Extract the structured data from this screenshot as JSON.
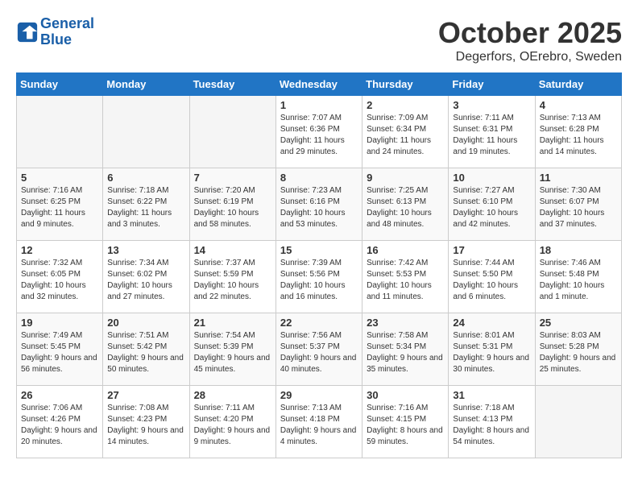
{
  "header": {
    "logo_line1": "General",
    "logo_line2": "Blue",
    "month": "October 2025",
    "location": "Degerfors, OErebro, Sweden"
  },
  "days_of_week": [
    "Sunday",
    "Monday",
    "Tuesday",
    "Wednesday",
    "Thursday",
    "Friday",
    "Saturday"
  ],
  "weeks": [
    [
      {
        "num": "",
        "info": ""
      },
      {
        "num": "",
        "info": ""
      },
      {
        "num": "",
        "info": ""
      },
      {
        "num": "1",
        "info": "Sunrise: 7:07 AM\nSunset: 6:36 PM\nDaylight: 11 hours and 29 minutes."
      },
      {
        "num": "2",
        "info": "Sunrise: 7:09 AM\nSunset: 6:34 PM\nDaylight: 11 hours and 24 minutes."
      },
      {
        "num": "3",
        "info": "Sunrise: 7:11 AM\nSunset: 6:31 PM\nDaylight: 11 hours and 19 minutes."
      },
      {
        "num": "4",
        "info": "Sunrise: 7:13 AM\nSunset: 6:28 PM\nDaylight: 11 hours and 14 minutes."
      }
    ],
    [
      {
        "num": "5",
        "info": "Sunrise: 7:16 AM\nSunset: 6:25 PM\nDaylight: 11 hours and 9 minutes."
      },
      {
        "num": "6",
        "info": "Sunrise: 7:18 AM\nSunset: 6:22 PM\nDaylight: 11 hours and 3 minutes."
      },
      {
        "num": "7",
        "info": "Sunrise: 7:20 AM\nSunset: 6:19 PM\nDaylight: 10 hours and 58 minutes."
      },
      {
        "num": "8",
        "info": "Sunrise: 7:23 AM\nSunset: 6:16 PM\nDaylight: 10 hours and 53 minutes."
      },
      {
        "num": "9",
        "info": "Sunrise: 7:25 AM\nSunset: 6:13 PM\nDaylight: 10 hours and 48 minutes."
      },
      {
        "num": "10",
        "info": "Sunrise: 7:27 AM\nSunset: 6:10 PM\nDaylight: 10 hours and 42 minutes."
      },
      {
        "num": "11",
        "info": "Sunrise: 7:30 AM\nSunset: 6:07 PM\nDaylight: 10 hours and 37 minutes."
      }
    ],
    [
      {
        "num": "12",
        "info": "Sunrise: 7:32 AM\nSunset: 6:05 PM\nDaylight: 10 hours and 32 minutes."
      },
      {
        "num": "13",
        "info": "Sunrise: 7:34 AM\nSunset: 6:02 PM\nDaylight: 10 hours and 27 minutes."
      },
      {
        "num": "14",
        "info": "Sunrise: 7:37 AM\nSunset: 5:59 PM\nDaylight: 10 hours and 22 minutes."
      },
      {
        "num": "15",
        "info": "Sunrise: 7:39 AM\nSunset: 5:56 PM\nDaylight: 10 hours and 16 minutes."
      },
      {
        "num": "16",
        "info": "Sunrise: 7:42 AM\nSunset: 5:53 PM\nDaylight: 10 hours and 11 minutes."
      },
      {
        "num": "17",
        "info": "Sunrise: 7:44 AM\nSunset: 5:50 PM\nDaylight: 10 hours and 6 minutes."
      },
      {
        "num": "18",
        "info": "Sunrise: 7:46 AM\nSunset: 5:48 PM\nDaylight: 10 hours and 1 minute."
      }
    ],
    [
      {
        "num": "19",
        "info": "Sunrise: 7:49 AM\nSunset: 5:45 PM\nDaylight: 9 hours and 56 minutes."
      },
      {
        "num": "20",
        "info": "Sunrise: 7:51 AM\nSunset: 5:42 PM\nDaylight: 9 hours and 50 minutes."
      },
      {
        "num": "21",
        "info": "Sunrise: 7:54 AM\nSunset: 5:39 PM\nDaylight: 9 hours and 45 minutes."
      },
      {
        "num": "22",
        "info": "Sunrise: 7:56 AM\nSunset: 5:37 PM\nDaylight: 9 hours and 40 minutes."
      },
      {
        "num": "23",
        "info": "Sunrise: 7:58 AM\nSunset: 5:34 PM\nDaylight: 9 hours and 35 minutes."
      },
      {
        "num": "24",
        "info": "Sunrise: 8:01 AM\nSunset: 5:31 PM\nDaylight: 9 hours and 30 minutes."
      },
      {
        "num": "25",
        "info": "Sunrise: 8:03 AM\nSunset: 5:28 PM\nDaylight: 9 hours and 25 minutes."
      }
    ],
    [
      {
        "num": "26",
        "info": "Sunrise: 7:06 AM\nSunset: 4:26 PM\nDaylight: 9 hours and 20 minutes."
      },
      {
        "num": "27",
        "info": "Sunrise: 7:08 AM\nSunset: 4:23 PM\nDaylight: 9 hours and 14 minutes."
      },
      {
        "num": "28",
        "info": "Sunrise: 7:11 AM\nSunset: 4:20 PM\nDaylight: 9 hours and 9 minutes."
      },
      {
        "num": "29",
        "info": "Sunrise: 7:13 AM\nSunset: 4:18 PM\nDaylight: 9 hours and 4 minutes."
      },
      {
        "num": "30",
        "info": "Sunrise: 7:16 AM\nSunset: 4:15 PM\nDaylight: 8 hours and 59 minutes."
      },
      {
        "num": "31",
        "info": "Sunrise: 7:18 AM\nSunset: 4:13 PM\nDaylight: 8 hours and 54 minutes."
      },
      {
        "num": "",
        "info": ""
      }
    ]
  ]
}
